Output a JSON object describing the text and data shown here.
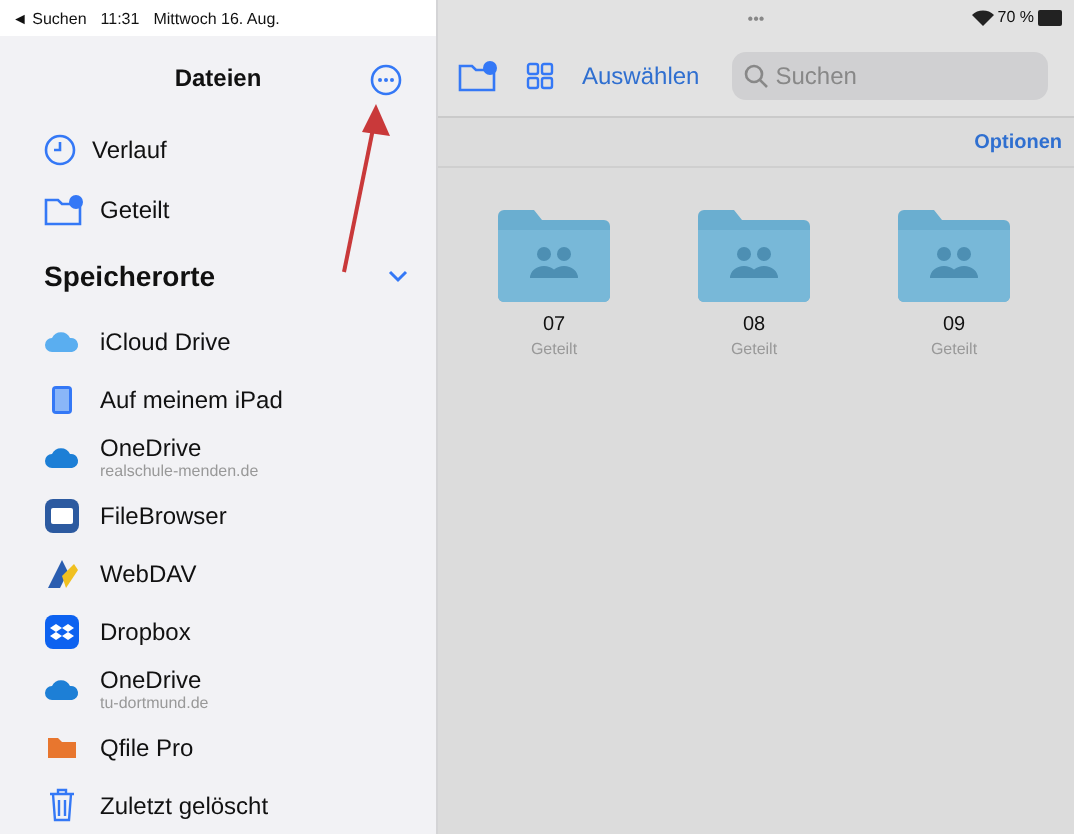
{
  "status_bar": {
    "back": "◄ Suchen",
    "time": "11:31",
    "date": "Mittwoch 16. Aug.",
    "dots": "•••",
    "battery": "70 %"
  },
  "sidebar": {
    "title": "Dateien",
    "items": [
      {
        "label": "Verlauf"
      },
      {
        "label": "Geteilt"
      }
    ],
    "section": {
      "title": "Speicherorte",
      "expanded": true
    },
    "locations": [
      {
        "label": "iCloud Drive"
      },
      {
        "label": "Auf meinem iPad"
      },
      {
        "label": "OneDrive",
        "subtitle": "realschule-menden.de"
      },
      {
        "label": "FileBrowser"
      },
      {
        "label": "WebDAV"
      },
      {
        "label": "Dropbox"
      },
      {
        "label": "OneDrive",
        "subtitle": "tu-dortmund.de"
      },
      {
        "label": "Qfile Pro"
      },
      {
        "label": "Zuletzt gelöscht"
      }
    ]
  },
  "toolbar": {
    "select": "Auswählen",
    "search": {
      "placeholder": "Suchen"
    },
    "options": "Optionen"
  },
  "folders": [
    {
      "name": "07",
      "caption": "Geteilt"
    },
    {
      "name": "08",
      "caption": "Geteilt"
    },
    {
      "name": "09",
      "caption": "Geteilt"
    }
  ]
}
